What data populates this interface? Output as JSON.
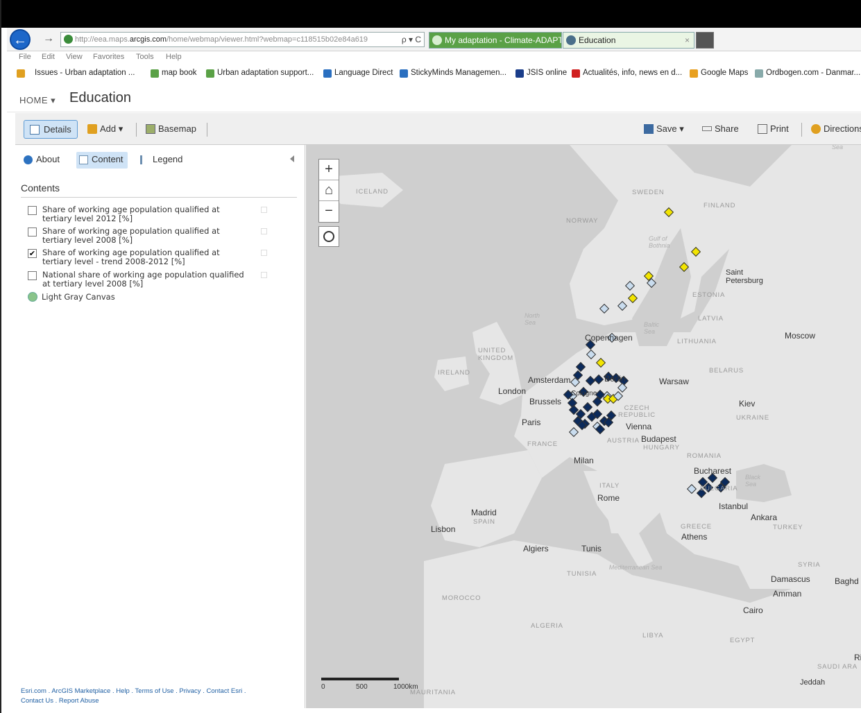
{
  "browser": {
    "url_prefix": "http://eea.maps.",
    "url_domain": "arcgis.com",
    "url_rest": "/home/webmap/viewer.html?webmap=c118515b02e84a619",
    "url_controls": "ρ ▾ C",
    "tabs": [
      {
        "label": "My adaptation - Climate-ADAPT"
      },
      {
        "label": "Education",
        "close": "×"
      }
    ],
    "menu": [
      "File",
      "Edit",
      "View",
      "Favorites",
      "Tools",
      "Help"
    ],
    "favorites": [
      "Issues - Urban adaptation ...",
      "map book",
      "Urban adaptation support...",
      "Language Direct",
      "StickyMinds Managemen...",
      "JSIS online",
      "Actualités, info, news en d...",
      "Google Maps",
      "Ordbogen.com - Danmar..."
    ]
  },
  "header": {
    "home_label": "HOME ▾",
    "title": "Education"
  },
  "toolbar": {
    "details": "Details",
    "add": "Add ▾",
    "basemap": "Basemap",
    "save": "Save ▾",
    "share": "Share",
    "print": "Print",
    "directions": "Directions"
  },
  "panel": {
    "tabs": {
      "about": "About",
      "content": "Content",
      "legend": "Legend"
    },
    "contents_heading": "Contents",
    "layers": [
      {
        "label": "Share of working age population qualified at tertiary level 2012 [%]",
        "checked": false
      },
      {
        "label": "Share of working age population qualified at tertiary level 2008 [%]",
        "checked": false
      },
      {
        "label": "Share of working age population qualified at tertiary level - trend 2008-2012 [%]",
        "checked": true
      },
      {
        "label": "National share of working age population qualified at tertiary level 2008 [%]",
        "checked": false
      }
    ],
    "basemap_layer": "Light Gray Canvas",
    "footer_line1": "Esri.com . ArcGIS Marketplace . Help . Terms of Use . Privacy . Contact Esri .",
    "footer_line2": "Contact Us . Report Abuse"
  },
  "map": {
    "zoom_in": "+",
    "home": "⌂",
    "zoom_out": "−",
    "scale": {
      "s0": "0",
      "s500": "500",
      "s1000": "1000km"
    },
    "labels": {
      "iceland": "ICELAND",
      "sweden": "SWEDEN",
      "finland": "FINLAND",
      "norway": "NORWAY",
      "gulf": "Gulf of Bothnia",
      "saint_petersburg": "Saint Petersburg",
      "estonia": "ESTONIA",
      "north_sea": "North Sea",
      "baltic": "Baltic Sea",
      "latvia": "LATVIA",
      "lithuania": "LITHUANIA",
      "copenhagen": "Copenhagen",
      "moscow": "Moscow",
      "uk": "UNITED KINGDOM",
      "ireland": "IRELAND",
      "amsterdam": "Amsterdam",
      "berlin": "Berlin",
      "belarus": "BELARUS",
      "warsaw": "Warsaw",
      "london": "London",
      "brussels": "Brussels",
      "cologne": "Cologne",
      "kiev": "Kiev",
      "czech": "CZECH REPUBLIC",
      "ukraine": "UKRAINE",
      "paris": "Paris",
      "vienna": "Vienna",
      "austria": "AUSTRIA",
      "budapest": "Budapest",
      "hungary": "HUNGARY",
      "france": "FRANCE",
      "romania": "ROMANIA",
      "milan": "Milan",
      "bucharest": "Bucharest",
      "black_sea": "Black Sea",
      "italy": "ITALY",
      "rome": "Rome",
      "bulgaria": "BULGARIA",
      "istanbul": "Istanbul",
      "madrid": "Madrid",
      "spain": "SPAIN",
      "ankara": "Ankara",
      "lisbon": "Lisbon",
      "greece": "GREECE",
      "turkey": "TURKEY",
      "athens": "Athens",
      "algiers": "Algiers",
      "tunis": "Tunis",
      "syria": "SYRIA",
      "tunisia": "TUNISIA",
      "med_sea": "Mediterranean Sea",
      "damascus": "Damascus",
      "baghdad": "Baghd",
      "amman": "Amman",
      "morocco": "MOROCCO",
      "cairo": "Cairo",
      "algeria": "ALGERIA",
      "libya": "LIBYA",
      "egypt": "EGYPT",
      "saudi": "SAUDI ARA",
      "riyadh": "Ri",
      "jeddah": "Jeddah",
      "mauritania": "MAURITANIA",
      "sea_top": "Sea"
    },
    "markers": {
      "dark": "#0b2a5b",
      "light": "#c9dcee",
      "yellow": "#f2e400"
    }
  }
}
